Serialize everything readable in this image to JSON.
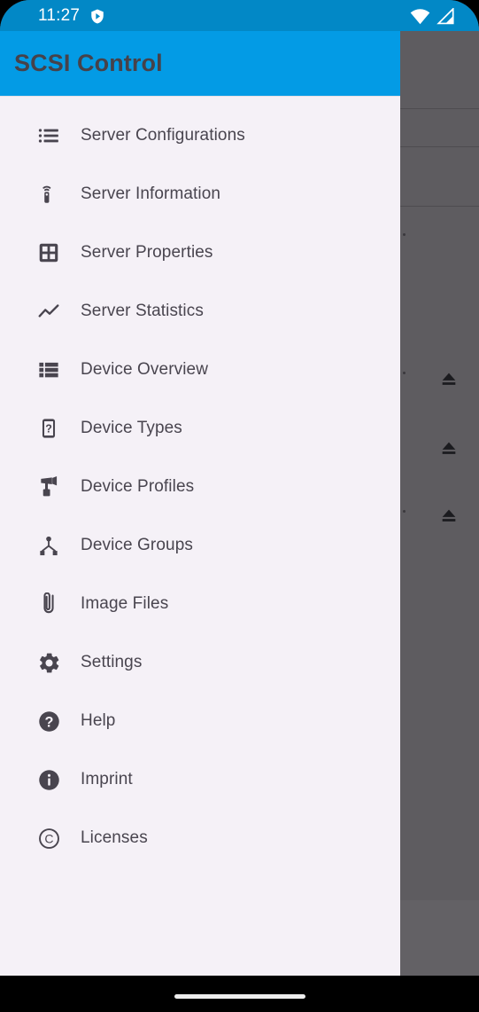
{
  "status_bar": {
    "time": "11:27",
    "icons": [
      "vpn-shield-icon",
      "wifi-icon",
      "cellular-signal-icon"
    ]
  },
  "drawer": {
    "title": "SCSI Control",
    "header_color": "#039BE5",
    "background_color": "#F5F1F7",
    "text_color": "#49454F",
    "items": [
      {
        "label": "Server Configurations",
        "icon": "list-bulleted-icon"
      },
      {
        "label": "Server Information",
        "icon": "remote-device-icon"
      },
      {
        "label": "Server Properties",
        "icon": "grid-table-icon"
      },
      {
        "label": "Server Statistics",
        "icon": "trending-up-icon"
      },
      {
        "label": "Device Overview",
        "icon": "view-list-icon"
      },
      {
        "label": "Device Types",
        "icon": "device-question-icon"
      },
      {
        "label": "Device Profiles",
        "icon": "device-profile-icon"
      },
      {
        "label": "Device Groups",
        "icon": "sitemap-icon"
      },
      {
        "label": "Image Files",
        "icon": "paperclip-icon"
      },
      {
        "label": "Settings",
        "icon": "gear-icon"
      },
      {
        "label": "Help",
        "icon": "help-circle-icon"
      },
      {
        "label": "Imprint",
        "icon": "info-circle-icon"
      },
      {
        "label": "Licenses",
        "icon": "copyright-icon"
      }
    ]
  },
  "background": {
    "scrim_color": "#5E5C60",
    "eject_buttons": [
      "eject-icon",
      "eject-icon",
      "eject-icon"
    ]
  },
  "nav_bar": {
    "gesture_handle": "home-gesture-pill"
  }
}
